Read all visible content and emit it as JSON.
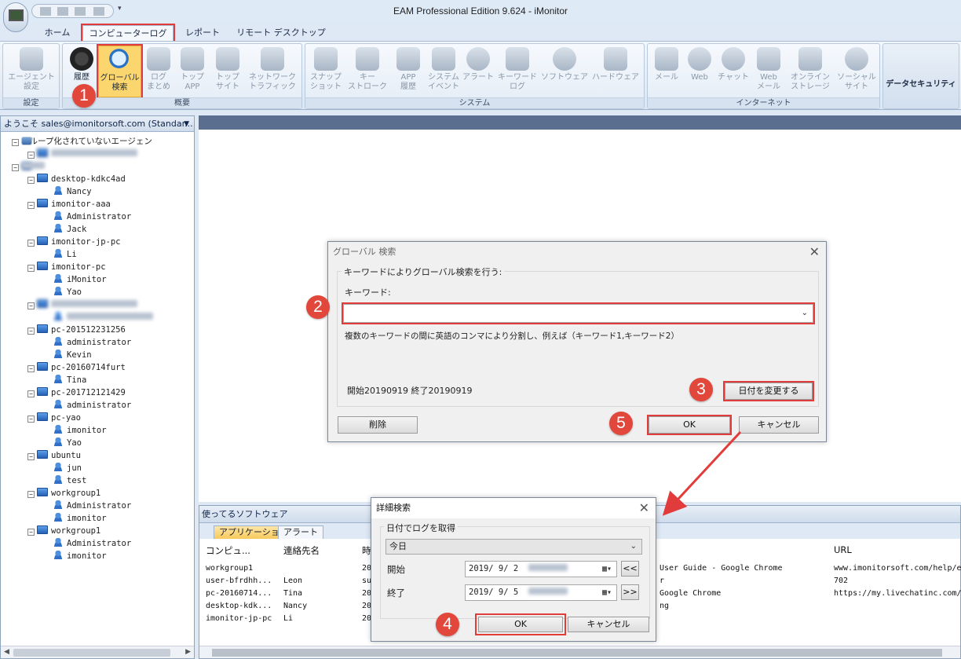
{
  "window": {
    "title": "EAM Professional Edition 9.624 - iMonitor"
  },
  "tabs": [
    "ホーム",
    "コンピューターログ",
    "レポート",
    "リモート デスクトップ"
  ],
  "ribbon": {
    "groups": {
      "settings": "設定",
      "overview": "概要",
      "system": "システム",
      "internet": "インターネット"
    },
    "buttons": {
      "agent_settings": [
        "エージェント",
        "設定"
      ],
      "history": [
        "履歴"
      ],
      "global_search": [
        "グローバル",
        "検索"
      ],
      "log_summary": [
        "ログ",
        "まとめ"
      ],
      "top_app": [
        "トップ",
        "APP"
      ],
      "top_site": [
        "トップ",
        "サイト"
      ],
      "network_traffic": [
        "ネットワーク",
        "トラフィック"
      ],
      "snapshot": [
        "スナップ",
        "ショット"
      ],
      "keystroke": [
        "キー",
        "ストローク"
      ],
      "app_history": [
        "APP",
        "履歴"
      ],
      "system_event": [
        "システム",
        "イベント"
      ],
      "alert": [
        "アラート"
      ],
      "keyword_log": [
        "キーワード",
        "ログ"
      ],
      "software": [
        "ソフトウェア"
      ],
      "hardware": [
        "ハードウェア"
      ],
      "mail": [
        "メール"
      ],
      "web": [
        "Web"
      ],
      "chat": [
        "チャット"
      ],
      "web_mail": [
        "Web",
        "メール"
      ],
      "online_storage": [
        "オンライン",
        "ストレージ"
      ],
      "social_site": [
        "ソーシャル",
        "サイト"
      ]
    },
    "data_security": "データセキュリティ"
  },
  "left_panel": {
    "header": "ようこそ sales@imonitorsoft.com (Standar...",
    "tree": [
      {
        "label": "グループ化されていないエージェン",
        "type": "group",
        "level": 0
      },
      {
        "label": "",
        "type": "computer",
        "level": 1,
        "blurred": true
      },
      {
        "label": "",
        "type": "group",
        "level": 0,
        "blurred": true
      },
      {
        "label": "desktop-kdkc4ad",
        "type": "computer",
        "level": 1
      },
      {
        "label": "Nancy",
        "type": "user",
        "level": 2
      },
      {
        "label": "imonitor-aaa",
        "type": "computer",
        "level": 1
      },
      {
        "label": "Administrator",
        "type": "user",
        "level": 2
      },
      {
        "label": "Jack",
        "type": "user",
        "level": 2
      },
      {
        "label": "imonitor-jp-pc",
        "type": "computer",
        "level": 1
      },
      {
        "label": "Li",
        "type": "user",
        "level": 2
      },
      {
        "label": "imonitor-pc",
        "type": "computer",
        "level": 1
      },
      {
        "label": "iMonitor",
        "type": "user",
        "level": 2
      },
      {
        "label": "Yao",
        "type": "user",
        "level": 2
      },
      {
        "label": "",
        "type": "computer",
        "level": 1,
        "blurred": true
      },
      {
        "label": "",
        "type": "user",
        "level": 2,
        "blurred": true
      },
      {
        "label": "pc-201512231256",
        "type": "computer",
        "level": 1
      },
      {
        "label": "administrator",
        "type": "user",
        "level": 2
      },
      {
        "label": "Kevin",
        "type": "user",
        "level": 2
      },
      {
        "label": "pc-20160714furt",
        "type": "computer",
        "level": 1
      },
      {
        "label": "Tina",
        "type": "user",
        "level": 2
      },
      {
        "label": "pc-201712121429",
        "type": "computer",
        "level": 1
      },
      {
        "label": "administrator",
        "type": "user",
        "level": 2
      },
      {
        "label": "pc-yao",
        "type": "computer",
        "level": 1
      },
      {
        "label": "imonitor",
        "type": "user",
        "level": 2
      },
      {
        "label": "Yao",
        "type": "user",
        "level": 2
      },
      {
        "label": "ubuntu",
        "type": "computer",
        "level": 1
      },
      {
        "label": "jun",
        "type": "user",
        "level": 2
      },
      {
        "label": "test",
        "type": "user",
        "level": 2
      },
      {
        "label": "workgroup1",
        "type": "computer",
        "level": 1
      },
      {
        "label": "Administrator",
        "type": "user",
        "level": 2
      },
      {
        "label": "imonitor",
        "type": "user",
        "level": 2
      },
      {
        "label": "workgroup1",
        "type": "computer",
        "level": 1
      },
      {
        "label": "Administrator",
        "type": "user",
        "level": 2
      },
      {
        "label": "imonitor",
        "type": "user",
        "level": 2
      }
    ]
  },
  "bottom_panel": {
    "title": "使ってるソフトウェア",
    "tabs": [
      "アプリケーション",
      "アラート"
    ],
    "columns": [
      "コンピュ...",
      "連絡先名",
      "時",
      "URL"
    ],
    "rows": [
      [
        "workgroup1",
        "",
        "20",
        "User Guide - Google Chrome",
        "www.imonitorsoft.com/help/e"
      ],
      [
        "user-bfrdhh...",
        "Leon",
        "su",
        "r",
        "702"
      ],
      [
        "pc-20160714...",
        "Tina",
        "20",
        "Google Chrome",
        "https://my.livechatinc.com/"
      ],
      [
        "desktop-kdk...",
        "Nancy",
        "20",
        "ng",
        ""
      ],
      [
        "imonitor-jp-pc",
        "Li",
        "20",
        "",
        ""
      ]
    ]
  },
  "global_search_dialog": {
    "title": "グローバル 検索",
    "section_label": "キーワードによりグローバル検索を行う:",
    "keyword_label": "キーワード:",
    "keyword_value": "",
    "hint": "複数のキーワードの間に英語のコンマにより分割し、例えば（キーワード1,キーワード2）",
    "date_range": "開始20190919 終了20190919",
    "change_date_button": "日付を変更する",
    "delete_button": "削除",
    "ok_button": "OK",
    "cancel_button": "キャンセル"
  },
  "advanced_search_dialog": {
    "title": "詳細検索",
    "section_label": "日付でログを取得",
    "period_value": "今日",
    "start_label": "開始",
    "start_value": "2019/ 9/ 2",
    "end_label": "終了",
    "end_value": "2019/ 9/ 5",
    "prev_button": "<<",
    "next_button": ">>",
    "ok_button": "OK",
    "cancel_button": "キャンセル"
  },
  "callouts": [
    "1",
    "2",
    "3",
    "4",
    "5"
  ],
  "colors": {
    "highlight_red": "#e23b3b",
    "callout_red": "#e2473c",
    "selected_button": "#fbd56d"
  }
}
